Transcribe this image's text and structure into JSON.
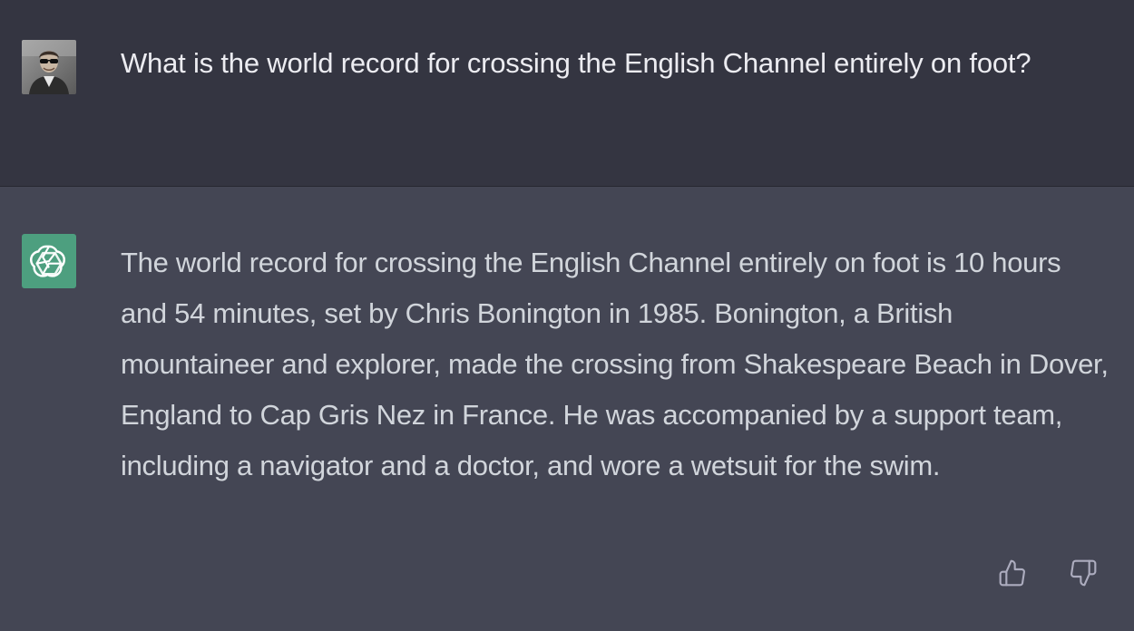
{
  "conversation": {
    "user_message": {
      "avatar_icon": "user-photo-avatar",
      "text": "What is the world record for crossing the English Channel entirely on foot?"
    },
    "assistant_message": {
      "avatar_icon": "openai-logo-icon",
      "avatar_color": "#4d9f7f",
      "text": "The world record for crossing the English Channel entirely on foot is 10 hours and 54 minutes, set by Chris Bonington in 1985. Bonington, a British mountaineer and explorer, made the crossing from Shakespeare Beach in Dover, England to Cap Gris Nez in France. He was accompanied by a support team, including a navigator and a doctor, and wore a wetsuit for the swim."
    },
    "feedback": {
      "thumbs_up_icon": "thumbs-up-icon",
      "thumbs_down_icon": "thumbs-down-icon"
    }
  },
  "colors": {
    "user_bg": "#343541",
    "assistant_bg": "#444654",
    "user_text": "#ececf1",
    "assistant_text": "#d1d5db",
    "icon_color": "#acacbe"
  }
}
